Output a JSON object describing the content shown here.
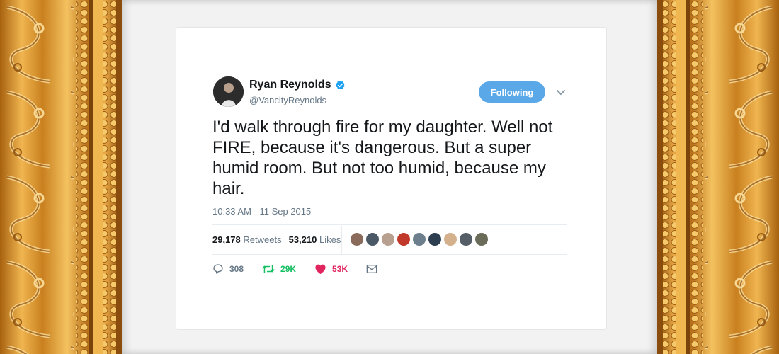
{
  "tweet": {
    "author_name": "Ryan Reynolds",
    "author_handle": "@VancityReynolds",
    "verified": true,
    "follow_button_label": "Following",
    "text": "I'd walk through fire for my daughter. Well not FIRE, because it's dangerous. But a super humid room. But not too humid, because my hair.",
    "timestamp": "10:33 AM - 11 Sep 2015",
    "retweets_count": "29,178",
    "retweets_label": "Retweets",
    "likes_count": "53,210",
    "likes_label": "Likes",
    "replies_short": "308",
    "retweets_short": "29K",
    "likes_short": "53K"
  },
  "icons": {
    "verified": "verified-badge-icon",
    "caret": "chevron-down-icon",
    "reply": "reply-icon",
    "retweet": "retweet-icon",
    "like": "heart-icon",
    "message": "direct-message-icon"
  },
  "colors": {
    "follow_button": "#5aa8e8",
    "retweet_green": "#17bf63",
    "like_red": "#e0245e",
    "secondary_text": "#657786",
    "frame_gold": "#d08a22"
  }
}
